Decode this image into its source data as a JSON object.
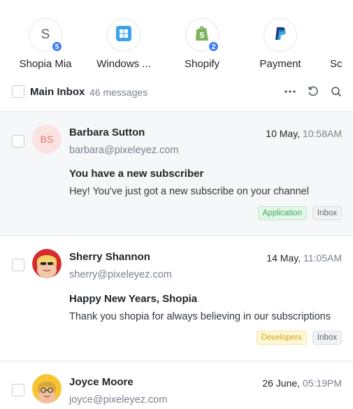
{
  "contacts": [
    {
      "letter": "S",
      "name": "Shopia Mia",
      "badge": "5"
    },
    {
      "name": "Windows ...",
      "icon": "windows-icon"
    },
    {
      "name": "Shopify",
      "badge": "2",
      "icon": "shopify-icon"
    },
    {
      "name": "Payment",
      "icon": "paypal-icon"
    },
    {
      "name": "Sc"
    }
  ],
  "toolbar": {
    "title": "Main Inbox",
    "count": "46 messages"
  },
  "messages": [
    {
      "initials": "BS",
      "sender": "Barbara Sutton",
      "email": "barbara@pixeleyez.com",
      "date": "10 May,",
      "time": "10:58AM",
      "subject": "You have a new subscriber",
      "preview": "Hey! You've just got a new subscribe on your channel",
      "tags": [
        "Application",
        "Inbox"
      ]
    },
    {
      "sender": "Sherry Shannon",
      "email": "sherry@pixeleyez.com",
      "date": "14 May,",
      "time": "11:05AM",
      "subject": "Happy New Years, Shopia",
      "preview": "Thank you shopia for always believing in our subscriptions",
      "tags": [
        "Developers",
        "Inbox"
      ]
    },
    {
      "sender": "Joyce Moore",
      "email": "joyce@pixeleyez.com",
      "date": "26 June,",
      "time": "05:19PM"
    }
  ],
  "colors": {
    "accent": "#3e7ef2",
    "selected_bg": "#f6f7f9",
    "application_tag": "#3aa860",
    "developers_tag": "#d6a21a"
  }
}
